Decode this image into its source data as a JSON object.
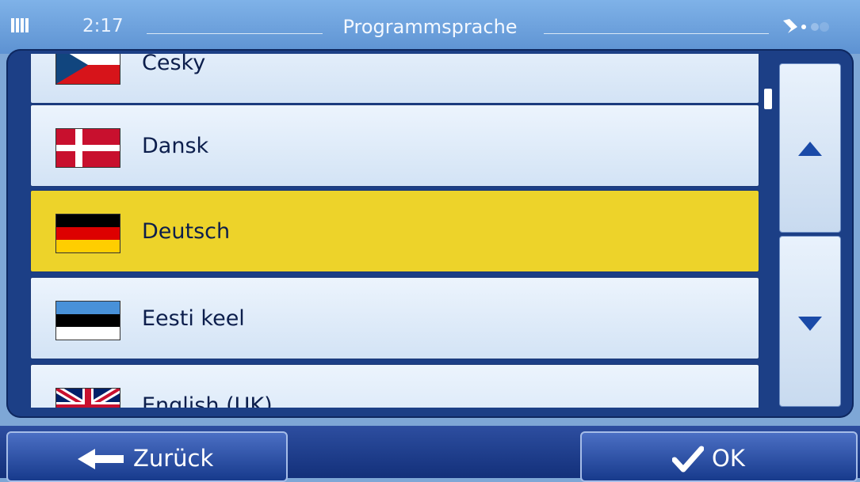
{
  "status_bar": {
    "time": "2:17",
    "title": "Programmsprache",
    "signal_icon": "signal-strength-icon",
    "gps_icon": "gps-satellite-icon"
  },
  "language_list": {
    "items": [
      {
        "label": "Česky",
        "flag": "czech-flag-icon",
        "selected": false
      },
      {
        "label": "Dansk",
        "flag": "danish-flag-icon",
        "selected": false
      },
      {
        "label": "Deutsch",
        "flag": "german-flag-icon",
        "selected": true
      },
      {
        "label": "Eesti keel",
        "flag": "estonian-flag-icon",
        "selected": false
      },
      {
        "label": "English (UK)",
        "flag": "uk-flag-icon",
        "selected": false
      }
    ]
  },
  "scroll": {
    "up_icon": "arrow-up-icon",
    "down_icon": "arrow-down-icon"
  },
  "buttons": {
    "back_label": "Zurück",
    "back_icon": "arrow-left-icon",
    "ok_label": "OK",
    "ok_icon": "checkmark-icon"
  },
  "colors": {
    "selected_row": "#edd32a",
    "panel": "#1c3f86",
    "accent": "#1a4aa8"
  }
}
